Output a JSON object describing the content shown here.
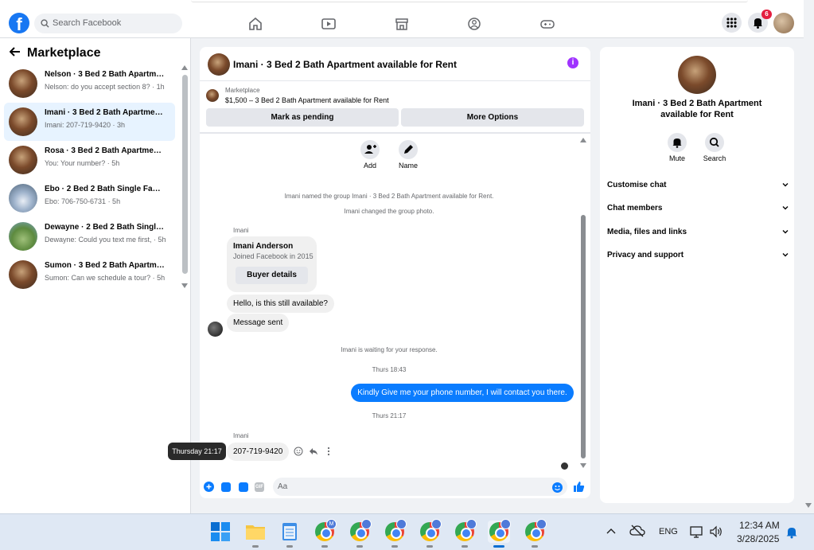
{
  "topbar": {
    "logo_letter": "f",
    "search_placeholder": "Search Facebook",
    "notification_count": "6",
    "nav_icons": [
      "home-icon",
      "video-icon",
      "marketplace-icon",
      "groups-icon",
      "gaming-icon"
    ]
  },
  "sidebar": {
    "title": "Marketplace",
    "conversations": [
      {
        "title": "Nelson · 3 Bed 2 Bath Apartme...",
        "preview": "Nelson: do you accept section 8? · 1h"
      },
      {
        "title": "Imani · 3 Bed 2 Bath Apartmen...",
        "preview": "Imani: 207-719-9420 · 3h"
      },
      {
        "title": "Rosa · 3 Bed 2 Bath Apartment ...",
        "preview": "You: Your number? · 5h"
      },
      {
        "title": "Ebo · 2 Bed 2 Bath Single Famil...",
        "preview": "Ebo: 706-750-6731 · 5h"
      },
      {
        "title": "Dewayne · 2 Bed 2 Bath Single ...",
        "preview": "Dewayne: Could you text me first, · 5h"
      },
      {
        "title": "Sumon · 3 Bed 2 Bath Apartme...",
        "preview": "Sumon: Can we schedule a tour? · 5h"
      }
    ]
  },
  "chat": {
    "title": "Imani · 3 Bed 2 Bath Apartment available for Rent",
    "info_icon": "i",
    "marketplace_label": "Marketplace",
    "listing": "$1,500 – 3 Bed 2 Bath Apartment available for Rent",
    "mark_pending": "Mark as pending",
    "more_options": "More Options",
    "add_label": "Add",
    "name_label": "Name",
    "sys1": "Imani named the group Imani · 3 Bed 2 Bath Apartment available for Rent.",
    "sys2": "Imani changed the group photo.",
    "sender1": "Imani",
    "card_name": "Imani Anderson",
    "card_joined": "Joined Facebook in 2015",
    "buyer_details": "Buyer details",
    "msg1": "Hello, is this still available?",
    "msg2": "Message sent",
    "waiting": "Imani is waiting for your response.",
    "time1": "Thurs 18:43",
    "outgoing": "Kindly Give me your phone number, I will contact you there.",
    "time2": "Thurs 21:17",
    "sender2": "Imani",
    "msg3": "207-719-9420",
    "tooltip": "Thursday 21:17",
    "composer_placeholder": "Aa",
    "gif_label": "GIF"
  },
  "details": {
    "name": "Imani · 3 Bed 2 Bath Apartment available for Rent",
    "mute": "Mute",
    "search": "Search",
    "sections": [
      "Customise chat",
      "Chat members",
      "Media, files and links",
      "Privacy and support"
    ]
  },
  "taskbar": {
    "lang": "ENG",
    "time": "12:34 AM",
    "date": "3/28/2025",
    "profile_letter": "M"
  },
  "colors": {
    "accent": "#1877f2",
    "bubble_out": "#0a7cff",
    "badge": "#e41e3f",
    "info": "#a033ff"
  }
}
